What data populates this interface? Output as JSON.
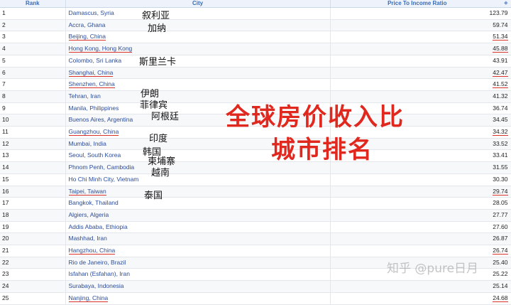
{
  "headers": {
    "rank": "Rank",
    "city": "City",
    "ratio": "Price To Income Ratio"
  },
  "rows": [
    {
      "rank": "1",
      "city": "Damascus, Syria",
      "ratio": "123.79",
      "hl": false
    },
    {
      "rank": "2",
      "city": "Accra, Ghana",
      "ratio": "59.74",
      "hl": false
    },
    {
      "rank": "3",
      "city": "Beijing, China",
      "ratio": "51.34",
      "hl": true
    },
    {
      "rank": "4",
      "city": "Hong Kong, Hong Kong",
      "ratio": "45.88",
      "hl": true
    },
    {
      "rank": "5",
      "city": "Colombo, Sri Lanka",
      "ratio": "43.91",
      "hl": false
    },
    {
      "rank": "6",
      "city": "Shanghai, China",
      "ratio": "42.47",
      "hl": true
    },
    {
      "rank": "7",
      "city": "Shenzhen, China",
      "ratio": "41.52",
      "hl": true
    },
    {
      "rank": "8",
      "city": "Tehran, Iran",
      "ratio": "41.32",
      "hl": false
    },
    {
      "rank": "9",
      "city": "Manila, Philippines",
      "ratio": "36.74",
      "hl": false
    },
    {
      "rank": "10",
      "city": "Buenos Aires, Argentina",
      "ratio": "34.45",
      "hl": false
    },
    {
      "rank": "11",
      "city": "Guangzhou, China",
      "ratio": "34.32",
      "hl": true
    },
    {
      "rank": "12",
      "city": "Mumbai, India",
      "ratio": "33.52",
      "hl": false
    },
    {
      "rank": "13",
      "city": "Seoul, South Korea",
      "ratio": "33.41",
      "hl": false
    },
    {
      "rank": "14",
      "city": "Phnom Penh, Cambodia",
      "ratio": "31.55",
      "hl": false
    },
    {
      "rank": "15",
      "city": "Ho Chi Minh City, Vietnam",
      "ratio": "30.30",
      "hl": false
    },
    {
      "rank": "16",
      "city": "Taipei, Taiwan",
      "ratio": "29.74",
      "hl": true
    },
    {
      "rank": "17",
      "city": "Bangkok, Thailand",
      "ratio": "28.05",
      "hl": false
    },
    {
      "rank": "18",
      "city": "Algiers, Algeria",
      "ratio": "27.77",
      "hl": false
    },
    {
      "rank": "19",
      "city": "Addis Ababa, Ethiopia",
      "ratio": "27.60",
      "hl": false
    },
    {
      "rank": "20",
      "city": "Mashhad, Iran",
      "ratio": "26.87",
      "hl": false
    },
    {
      "rank": "21",
      "city": "Hangzhou, China",
      "ratio": "26.74",
      "hl": true
    },
    {
      "rank": "22",
      "city": "Rio de Janeiro, Brazil",
      "ratio": "25.40",
      "hl": false
    },
    {
      "rank": "23",
      "city": "Isfahan (Esfahan), Iran",
      "ratio": "25.22",
      "hl": false
    },
    {
      "rank": "24",
      "city": "Surabaya, Indonesia",
      "ratio": "25.14",
      "hl": false
    },
    {
      "rank": "25",
      "city": "Nanjing, China",
      "ratio": "24.68",
      "hl": true
    }
  ],
  "annotations": {
    "syria": "叙利亚",
    "ghana": "加纳",
    "srilanka": "斯里兰卡",
    "iran": "伊朗",
    "philippines": "菲律宾",
    "argentina": "阿根廷",
    "india": "印度",
    "korea": "韩国",
    "cambodia": "柬埔寨",
    "vietnam": "越南",
    "thailand": "泰国"
  },
  "title": {
    "line1": "全球房价收入比",
    "line2": "城市排名"
  },
  "watermark": "知乎 @pure日月",
  "colors": {
    "header_text": "#3a6bb3",
    "link": "#2b4c9b",
    "highlight": "#d9332b",
    "title": "#e0281e"
  }
}
